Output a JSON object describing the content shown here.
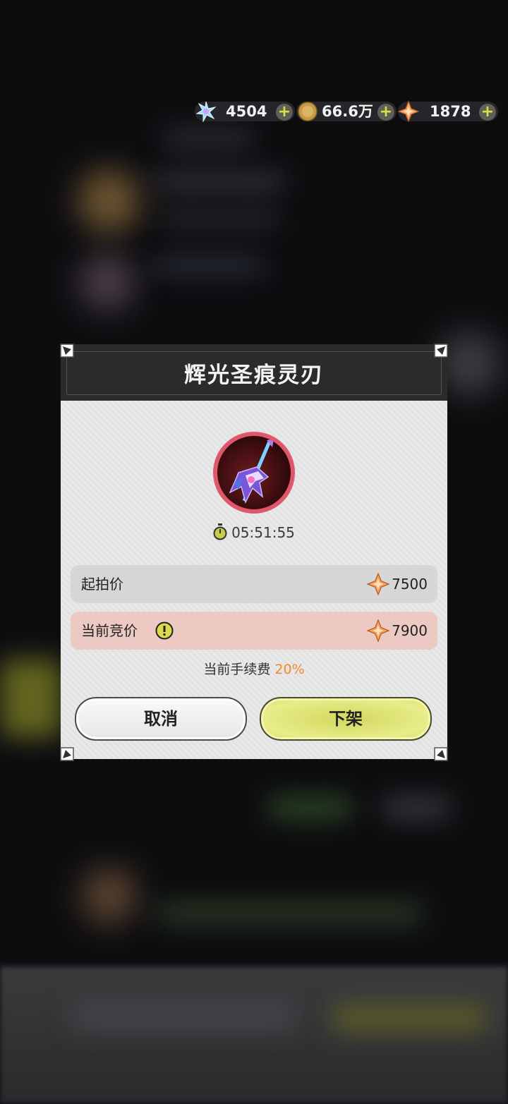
{
  "currency": {
    "gems": "4504",
    "coins": "66.6万",
    "crystals": "1878"
  },
  "dialog": {
    "title": "辉光圣痕灵刃",
    "timer": "05:51:55",
    "start_price_label": "起拍价",
    "start_price_value": "7500",
    "current_bid_label": "当前竞价",
    "current_bid_value": "7900",
    "fee_label": "当前手续费",
    "fee_value": "20%",
    "cancel_label": "取消",
    "delist_label": "下架"
  },
  "icons": [
    "snowflake-gem-icon",
    "gold-coin-icon",
    "orange-crystal-icon",
    "plus-icon",
    "stopwatch-icon",
    "info-icon",
    "sword-item-icon"
  ],
  "colors": {
    "accent_yellow": "#d8e14a",
    "fee_orange": "#f08a2a",
    "bid_row": "#ecc9c2"
  }
}
